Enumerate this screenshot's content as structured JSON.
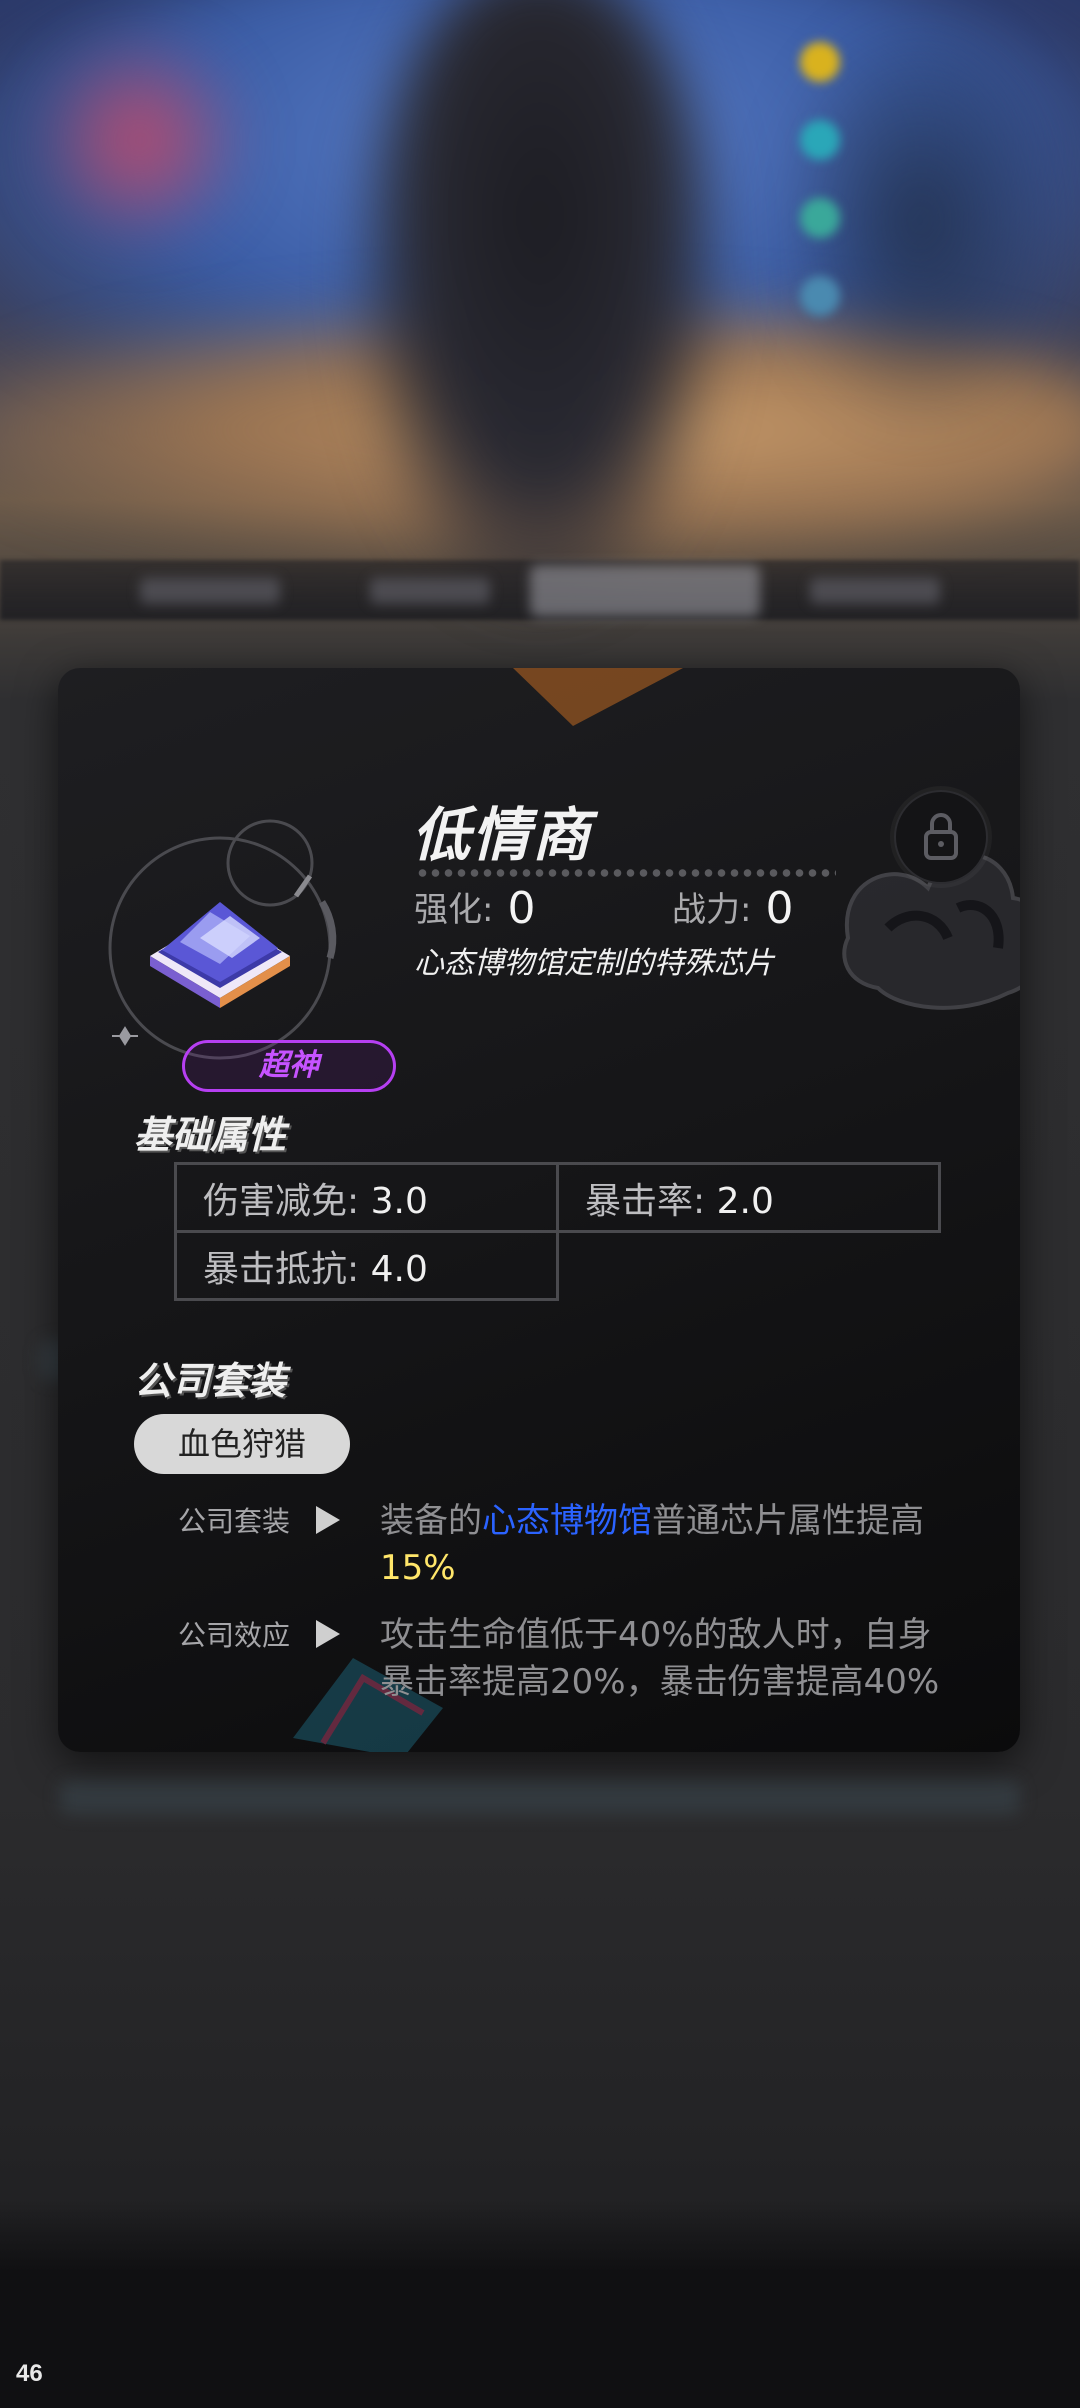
{
  "status": {
    "fps": "46"
  },
  "item": {
    "name": "低情商",
    "enhance_label": "强化:",
    "enhance_value": "0",
    "power_label": "战力:",
    "power_value": "0",
    "description": "心态博物馆定制的特殊芯片",
    "rarity": "超神",
    "locked": true
  },
  "base_attributes": {
    "title": "基础属性",
    "rows": [
      [
        {
          "label": "伤害减免:",
          "value": "3.0"
        },
        {
          "label": "暴击率:",
          "value": "2.0"
        }
      ],
      [
        {
          "label": "暴击抵抗:",
          "value": "4.0"
        }
      ]
    ]
  },
  "company_set": {
    "title": "公司套装",
    "set_name": "血色狩猎",
    "effects": [
      {
        "label": "公司套装",
        "parts": [
          {
            "text": "装备的",
            "style": "normal"
          },
          {
            "text": "心态博物馆",
            "style": "blue"
          },
          {
            "text": "普通芯片属性提高",
            "style": "normal"
          },
          {
            "text": "15%",
            "style": "yellow"
          }
        ]
      },
      {
        "label": "公司效应",
        "text": "攻击生命值低于40%的敌人时，自身暴击率提高20%，暴击伤害提高40%"
      }
    ]
  },
  "colors": {
    "rarity": "#b63ff2",
    "highlight_blue": "#2b63ff",
    "highlight_yellow": "#ffe66a"
  }
}
